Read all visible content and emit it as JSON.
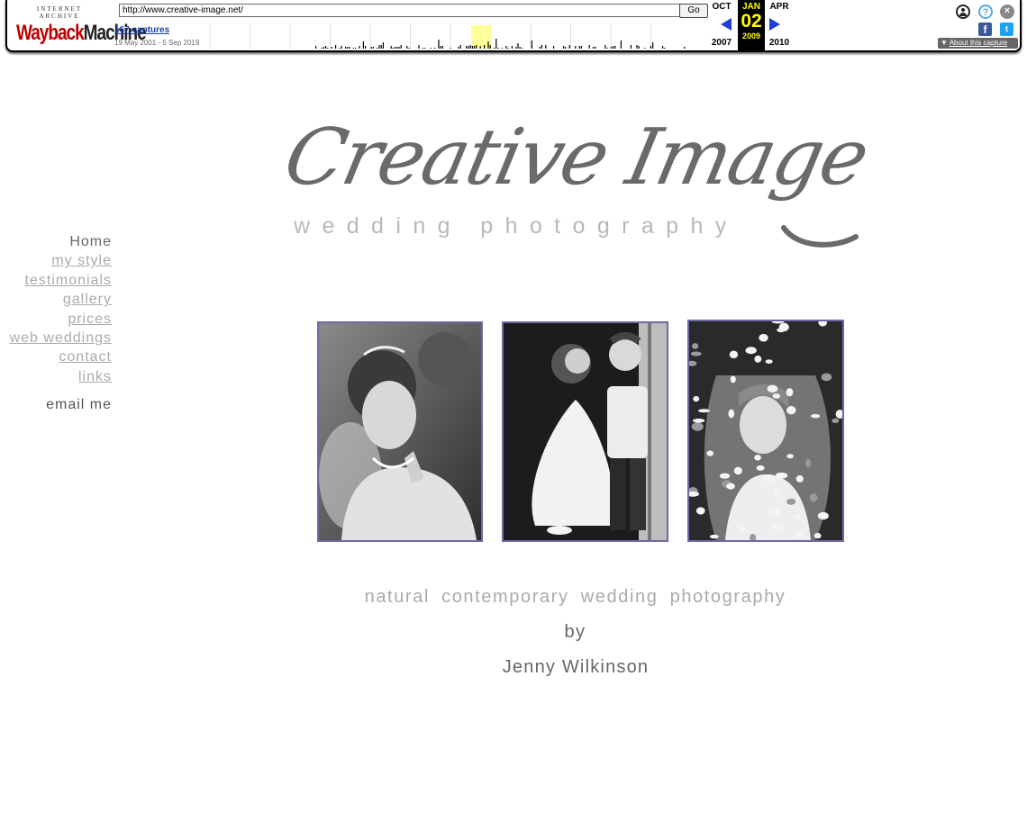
{
  "wayback": {
    "logo_top": "INTERNET ARCHIVE",
    "logo_main_a": "Wayback",
    "logo_main_b": "Machine",
    "url": "http://www.creative-image.net/",
    "go_label": "Go",
    "captures": "167 captures",
    "range": "19 May 2001 - 5 Sep 2019",
    "prev_month": "OCT",
    "cur_month": "JAN",
    "next_month": "APR",
    "cur_day": "02",
    "prev_year": "2007",
    "cur_year": "2009",
    "next_year": "2010",
    "about": "About this capture",
    "icons": {
      "user": "user-icon",
      "help": "help-icon",
      "close": "close-icon",
      "facebook": "facebook-icon",
      "twitter": "twitter-icon"
    },
    "accent": "#1f3ed6"
  },
  "site": {
    "logo_title": "Creative Image",
    "logo_subtitle": "wedding photography",
    "nav": [
      {
        "label": "Home",
        "active": true
      },
      {
        "label": "my style"
      },
      {
        "label": "testimonials"
      },
      {
        "label": "gallery"
      },
      {
        "label": "prices"
      },
      {
        "label": "web weddings"
      },
      {
        "label": "contact"
      },
      {
        "label": "links"
      }
    ],
    "email_label": "email me",
    "tagline": "natural contemporary wedding photography",
    "by": "by",
    "author": "Jenny Wilkinson",
    "photo_border_color": "#6a6aa6"
  }
}
